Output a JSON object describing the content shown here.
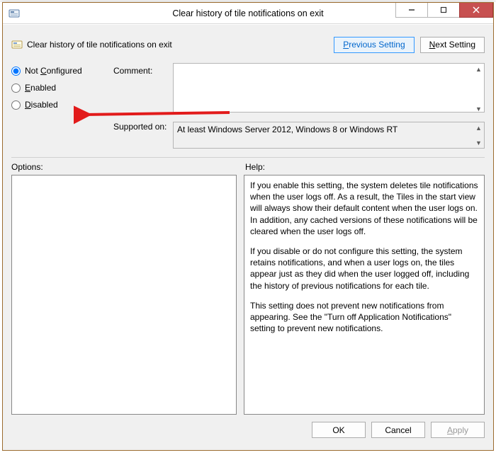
{
  "window": {
    "title": "Clear history of tile notifications on exit"
  },
  "header": {
    "title": "Clear history of tile notifications on exit",
    "prev": "Previous Setting",
    "next": "Next Setting"
  },
  "radios": {
    "not_configured": "Not Configured",
    "enabled": "Enabled",
    "disabled": "Disabled",
    "selected": "not_configured"
  },
  "labels": {
    "comment": "Comment:",
    "supported": "Supported on:",
    "options": "Options:",
    "help": "Help:"
  },
  "comment": "",
  "supported": "At least Windows Server 2012, Windows 8 or Windows RT",
  "help": {
    "p1": "If you enable this setting, the system deletes tile notifications when the user logs off. As a result, the Tiles in the start view will always show their default content when the user logs on. In addition, any cached versions of these notifications will be cleared when the user logs off.",
    "p2": "If you disable or do not configure this setting, the system retains notifications, and when a user logs on, the tiles appear just as they did when the user logged off, including the history of previous notifications for each tile.",
    "p3": "This setting does not prevent new notifications from appearing. See the \"Turn off Application Notifications\" setting to prevent new notifications."
  },
  "buttons": {
    "ok": "OK",
    "cancel": "Cancel",
    "apply": "Apply"
  }
}
